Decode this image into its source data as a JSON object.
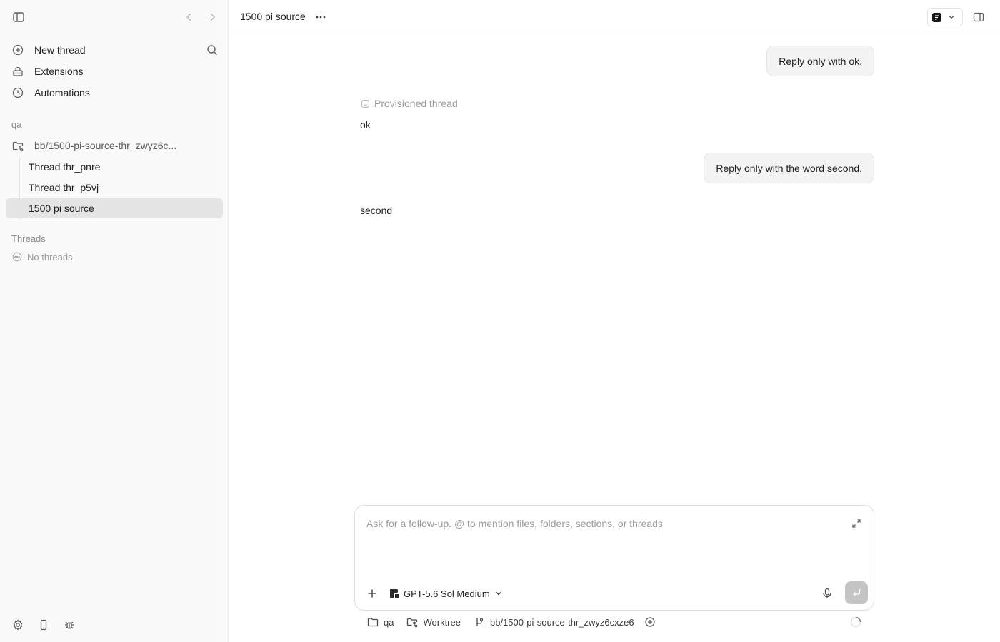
{
  "sidebar": {
    "nav": {
      "new_thread": "New thread",
      "extensions": "Extensions",
      "automations": "Automations"
    },
    "workspace_label": "qa",
    "project": {
      "name": "bb/1500-pi-source-thr_zwyz6c..."
    },
    "threads": [
      {
        "label": "Thread thr_pnre",
        "active": false
      },
      {
        "label": "Thread thr_p5vj",
        "active": false
      },
      {
        "label": "1500 pi source",
        "active": true
      }
    ],
    "threads_section_label": "Threads",
    "no_threads_label": "No threads"
  },
  "header": {
    "title": "1500 pi source"
  },
  "conversation": {
    "messages": [
      {
        "role": "user",
        "text": "Reply only with ok."
      },
      {
        "role": "system",
        "text": "Provisioned thread"
      },
      {
        "role": "assistant",
        "text": "ok"
      },
      {
        "role": "user",
        "text": "Reply only with the word second."
      },
      {
        "role": "assistant",
        "text": "second"
      }
    ]
  },
  "composer": {
    "placeholder": "Ask for a follow-up. @ to mention files, folders, sections, or threads",
    "value": "",
    "model": "GPT-5.6 Sol Medium"
  },
  "bottom_bar": {
    "folder": "qa",
    "mode": "Worktree",
    "branch": "bb/1500-pi-source-thr_zwyz6cxze6"
  },
  "colors": {
    "sidebar_bg": "#f9f9f9",
    "active_row": "#e4e4e4",
    "bubble_bg": "#f3f3f3",
    "send_button": "#c4c4c4"
  }
}
